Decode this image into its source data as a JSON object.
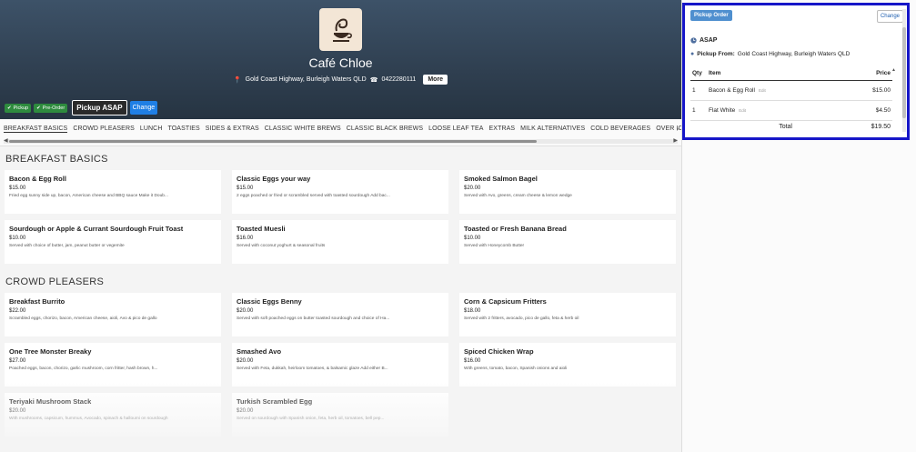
{
  "hero": {
    "title": "Café Chloe",
    "address": "Gold Coast Highway, Burleigh Waters QLD",
    "phone": "0422280111",
    "more_label": "More",
    "pills": [
      "Pickup",
      "Pre-Order"
    ],
    "asap_label": "Pickup ASAP",
    "change_label": "Change"
  },
  "categories": [
    "BREAKFAST BASICS",
    "CROWD PLEASERS",
    "LUNCH",
    "TOASTIES",
    "SIDES & EXTRAS",
    "CLASSIC WHITE BREWS",
    "CLASSIC BLACK BREWS",
    "LOOSE LEAF TEA",
    "EXTRAS",
    "MILK ALTERNATIVES",
    "COLD BEVERAGES",
    "OVER ICE"
  ],
  "sections": [
    {
      "title": "BREAKFAST BASICS",
      "items": [
        {
          "name": "Bacon & Egg Roll",
          "price": "$15.00",
          "desc": "Fried egg sunny side up, bacon, American cheese and BBQ sauce Make it Doub..."
        },
        {
          "name": "Classic Eggs your way",
          "price": "$15.00",
          "desc": "2 eggs poached or fried or scrambled served with toasted sourdough Add bac..."
        },
        {
          "name": "Smoked Salmon Bagel",
          "price": "$20.00",
          "desc": "Served with Avo, greens, cream cheese & lemon wedge"
        },
        {
          "name": "Sourdough or Apple & Currant Sourdough Fruit Toast",
          "price": "$10.00",
          "desc": "Served with choice of butter, jam, peanut butter or vegemite"
        },
        {
          "name": "Toasted Muesli",
          "price": "$16.00",
          "desc": "Served with coconut yoghurt & seasonal fruits"
        },
        {
          "name": "Toasted or Fresh Banana Bread",
          "price": "$10.00",
          "desc": "Served with Honeycomb Butter"
        }
      ]
    },
    {
      "title": "CROWD PLEASERS",
      "items": [
        {
          "name": "Breakfast Burrito",
          "price": "$22.00",
          "desc": "Scrambled eggs, chorizo, bacon, American cheese, aioli, Avo & pico de gallo"
        },
        {
          "name": "Classic Eggs Benny",
          "price": "$20.00",
          "desc": "Served with soft poached eggs on butter toasted sourdough and choice of Ha..."
        },
        {
          "name": "Corn & Capsicum Fritters",
          "price": "$18.00",
          "desc": "Served with 2 fritters, avocado, pico de gallo, feta & herb oil"
        },
        {
          "name": "One Tree Monster Breaky",
          "price": "$27.00",
          "desc": "Poached eggs, bacon, chorizo, garlic mushroom, corn fritter, hash brown, h..."
        },
        {
          "name": "Smashed Avo",
          "price": "$20.00",
          "desc": "Served with Feta, dukkah, heirloom tomatoes, & balsamic glaze Add either B..."
        },
        {
          "name": "Spiced Chicken Wrap",
          "price": "$16.00",
          "desc": "With greens, tomato, bacon, Spanish onions and aioli"
        },
        {
          "name": "Teriyaki Mushroom Stack",
          "price": "$20.00",
          "desc": "With mushrooms, capsicum, hummus, Avocado, spinach & halloumi on sourdough"
        },
        {
          "name": "Turkish Scrambled Egg",
          "price": "$20.00",
          "desc": "Served on sourdough with Spanish onion, feta, herb oil, tomatoes, bell pep..."
        }
      ]
    }
  ],
  "order": {
    "title": "Pickup Order",
    "change_label": "Change",
    "asap": "ASAP",
    "from_label": "Pickup From:",
    "from_value": "Gold Coast Highway, Burleigh Waters QLD",
    "headers": {
      "qty": "Qty",
      "item": "Item",
      "price": "Price"
    },
    "items": [
      {
        "qty": "1",
        "name": "Bacon & Egg Roll",
        "edit": "Edit",
        "price": "$15.00"
      },
      {
        "qty": "1",
        "name": "Flat White",
        "edit": "Edit",
        "price": "$4.50"
      }
    ],
    "total_label": "Total",
    "total_value": "$19.50"
  }
}
